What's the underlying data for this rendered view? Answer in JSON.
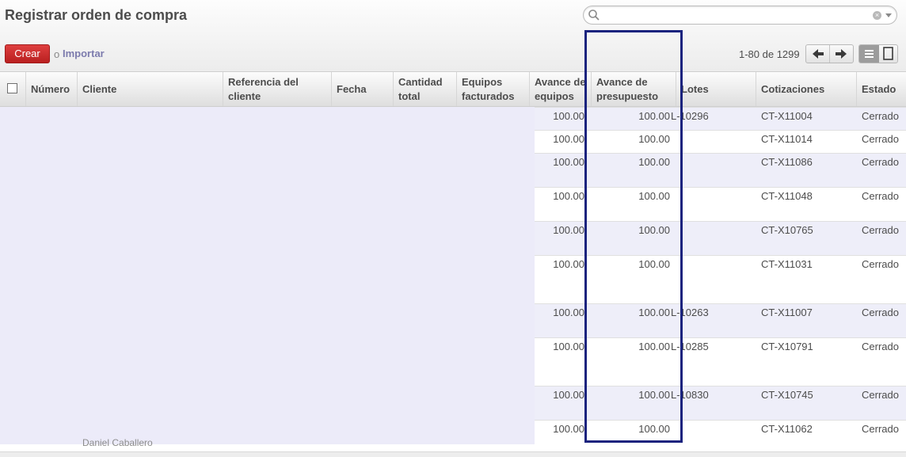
{
  "header": {
    "title": "Registrar orden de compra",
    "search_placeholder": "",
    "create_label": "Crear",
    "or_label": "o",
    "import_label": "Importar",
    "pager_value": "1-80 de 1299",
    "icons": [
      "search-icon",
      "clear-icon",
      "dropdown-icon",
      "prev-icon",
      "next-icon",
      "list-view-icon",
      "form-view-icon"
    ]
  },
  "table": {
    "columns": [
      "Número",
      "Cliente",
      "Referencia del cliente",
      "Fecha",
      "Cantidad total",
      "Equipos facturados",
      "Avance de equipos",
      "Avance de presupuesto",
      "Lotes",
      "Cotizaciones",
      "Estado"
    ],
    "rows": [
      {
        "equipos": "100.00",
        "presupuesto": "100.00",
        "lotes": "L-10296",
        "cotizacion": "CT-X11004",
        "estado": "Cerrado"
      },
      {
        "equipos": "100.00",
        "presupuesto": "100.00",
        "lotes": "",
        "cotizacion": "CT-X11014",
        "estado": "Cerrado"
      },
      {
        "equipos": "100.00",
        "presupuesto": "100.00",
        "lotes": "",
        "cotizacion": "CT-X11086",
        "estado": "Cerrado"
      },
      {
        "equipos": "100.00",
        "presupuesto": "100.00",
        "lotes": "",
        "cotizacion": "CT-X11048",
        "estado": "Cerrado"
      },
      {
        "equipos": "100.00",
        "presupuesto": "100.00",
        "lotes": "",
        "cotizacion": "CT-X10765",
        "estado": "Cerrado"
      },
      {
        "equipos": "100.00",
        "presupuesto": "100.00",
        "lotes": "",
        "cotizacion": "CT-X11031",
        "estado": "Cerrado"
      },
      {
        "equipos": "100.00",
        "presupuesto": "100.00",
        "lotes": "L-10263",
        "cotizacion": "CT-X11007",
        "estado": "Cerrado"
      },
      {
        "equipos": "100.00",
        "presupuesto": "100.00",
        "lotes": "L-10285",
        "cotizacion": "CT-X10791",
        "estado": "Cerrado"
      },
      {
        "equipos": "100.00",
        "presupuesto": "100.00",
        "lotes": "L-10830",
        "cotizacion": "CT-X10745",
        "estado": "Cerrado"
      },
      {
        "equipos": "100.00",
        "presupuesto": "100.00",
        "lotes": "",
        "cotizacion": "CT-X11062",
        "estado": "Cerrado"
      }
    ]
  },
  "footer": {
    "partial_text": "Daniel Caballero"
  },
  "colors": {
    "accent": "#c42a2a",
    "link": "#7c7bad",
    "highlight_border": "#1a237e",
    "band": "#eeeef9"
  }
}
